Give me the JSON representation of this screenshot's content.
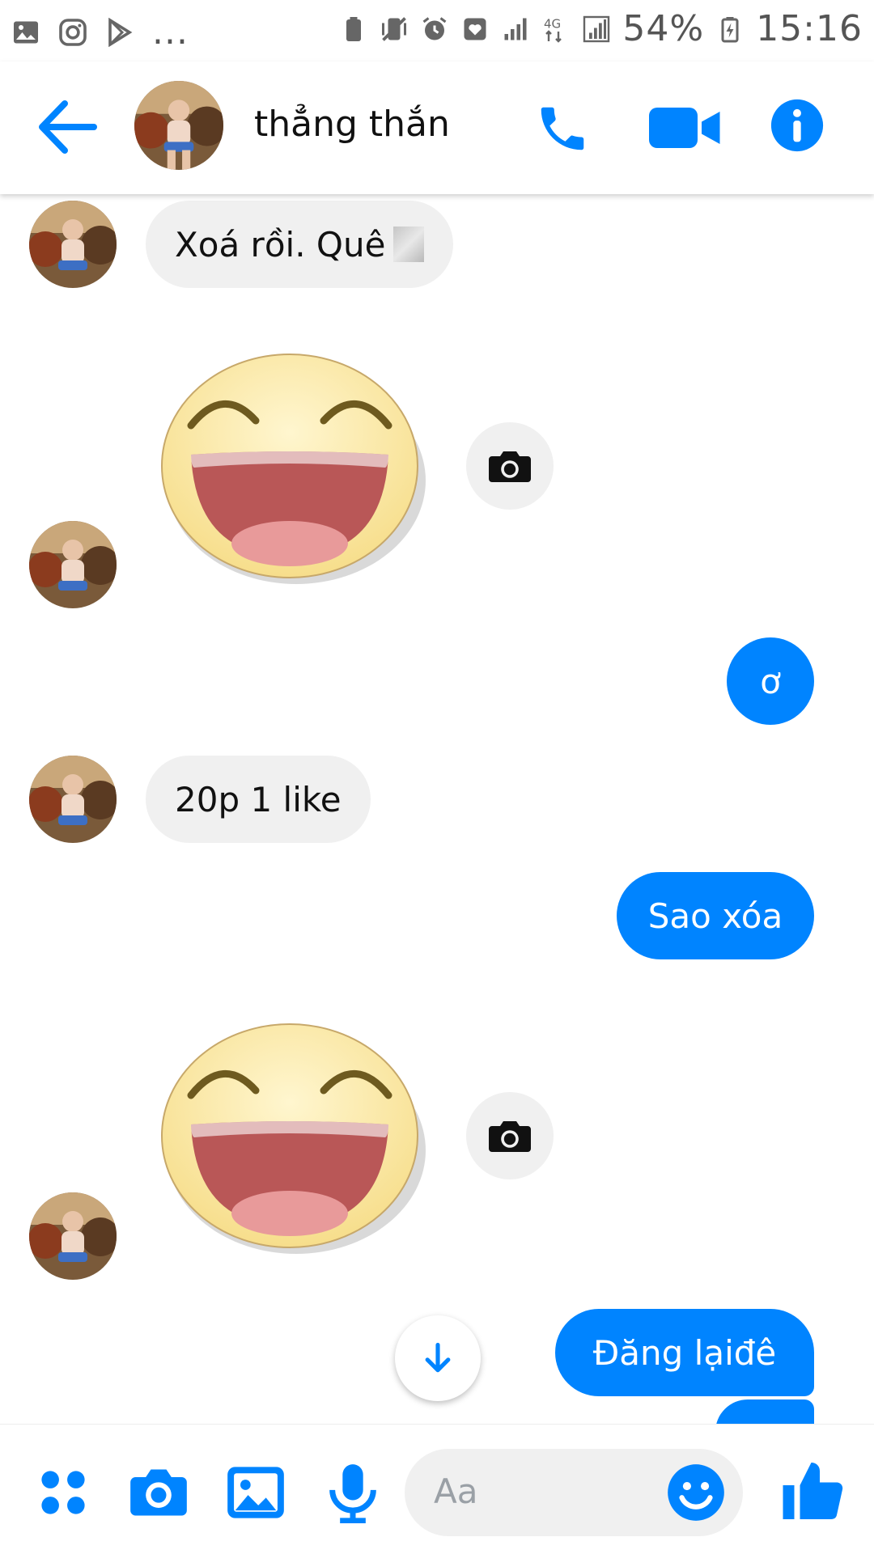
{
  "status_bar": {
    "battery": "54%",
    "time": "15:16",
    "more": "..."
  },
  "header": {
    "contact_name": "thẳng thắn"
  },
  "messages": [
    {
      "direction": "in",
      "type": "text",
      "text": "Xoá rồi. Quê"
    },
    {
      "direction": "in",
      "type": "sticker"
    },
    {
      "direction": "out",
      "type": "text",
      "text": "ơ"
    },
    {
      "direction": "in",
      "type": "text",
      "text": "20p 1 like"
    },
    {
      "direction": "out",
      "type": "text",
      "text": "Sao xóa"
    },
    {
      "direction": "in",
      "type": "sticker"
    },
    {
      "direction": "out",
      "type": "text",
      "text": "Đăng lạiđê"
    }
  ],
  "composer": {
    "placeholder": "Aa"
  },
  "colors": {
    "accent": "#0084ff",
    "incoming_bubble": "#f0f0f0"
  },
  "icons": [
    "image-icon",
    "instagram-icon",
    "play-store-icon",
    "back-arrow-icon",
    "phone-icon",
    "video-camera-icon",
    "info-icon",
    "camera-icon",
    "arrow-down-icon",
    "apps-icon",
    "gallery-icon",
    "microphone-icon",
    "emoji-icon",
    "thumbs-up-icon"
  ]
}
